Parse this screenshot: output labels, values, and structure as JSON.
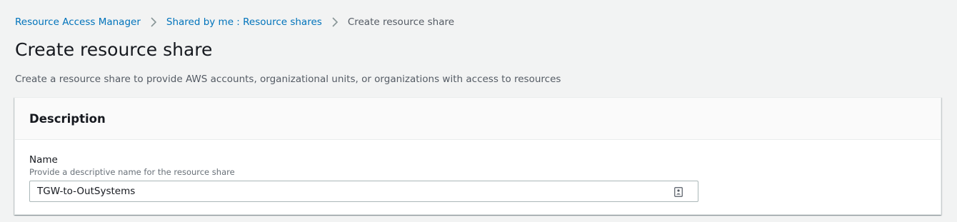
{
  "breadcrumb": {
    "items": [
      {
        "label": "Resource Access Manager"
      },
      {
        "label": "Shared by me : Resource shares"
      },
      {
        "label": "Create resource share"
      }
    ],
    "separator_icon": "chevron-right-icon"
  },
  "header": {
    "title": "Create resource share",
    "description": "Create a resource share to provide AWS accounts, organizational units, or organizations with access to resources"
  },
  "description_panel": {
    "title": "Description",
    "name_field": {
      "label": "Name",
      "hint": "Provide a descriptive name for the resource share",
      "value": "TGW-to-OutSystems",
      "trailing_icon": "contact-card-icon"
    }
  },
  "colors": {
    "link": "#0073bb",
    "page_background": "#f2f3f3",
    "text": "#16191f",
    "muted_text": "#545b64"
  }
}
